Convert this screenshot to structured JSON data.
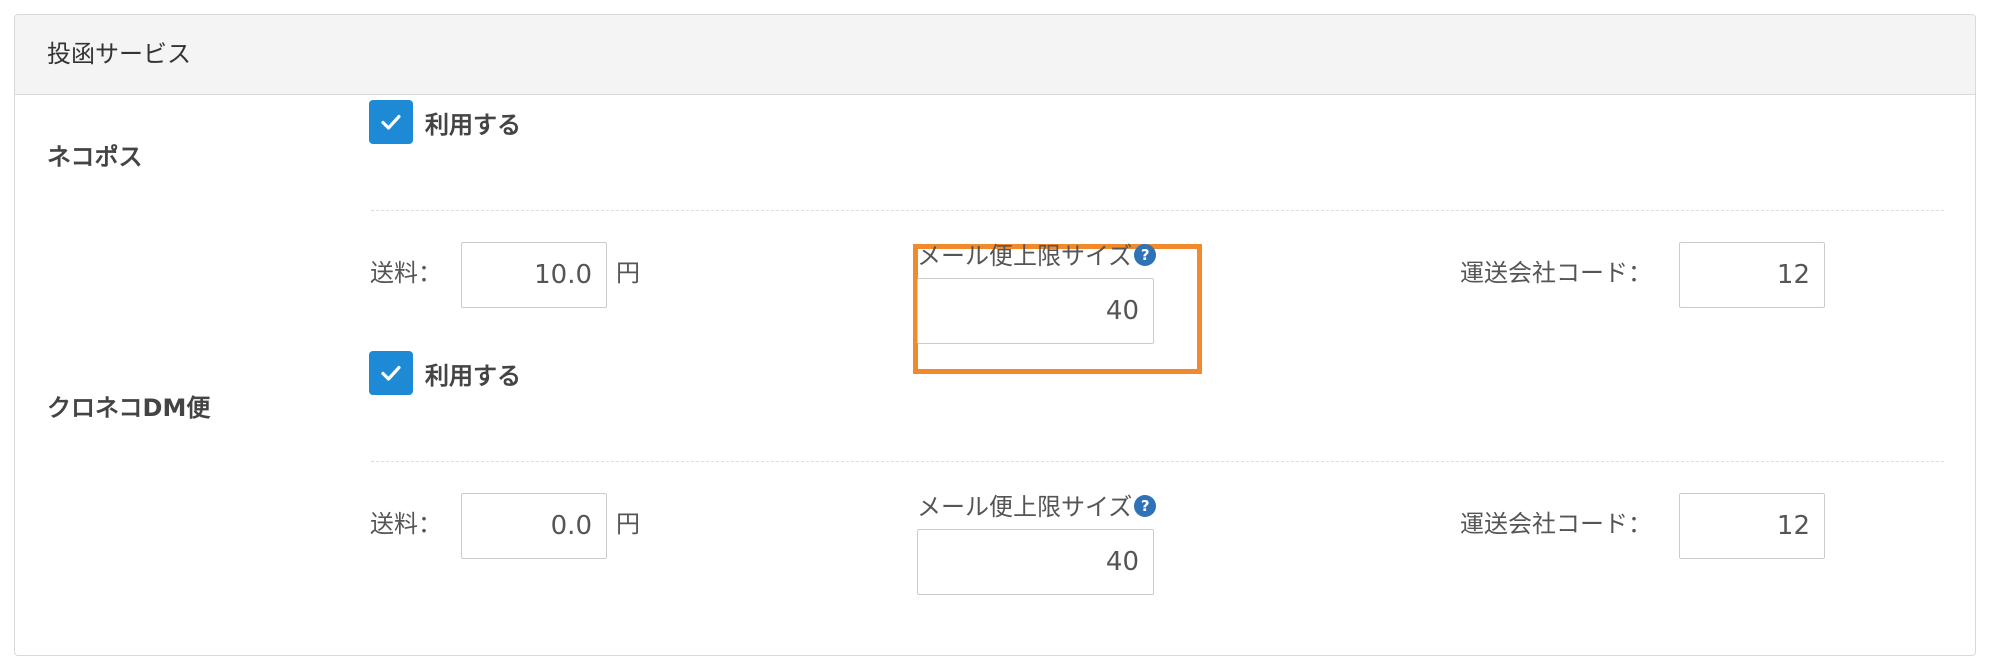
{
  "panel": {
    "title": "投函サービス"
  },
  "services": [
    {
      "name": "ネコポス",
      "use_checkbox": {
        "checked": true,
        "label": "利用する"
      },
      "shipping_fee": {
        "label": "送料：",
        "value": "10.0",
        "unit": "円"
      },
      "mail_size_limit": {
        "label": "メール便上限サイズ",
        "value": "40",
        "help_icon": "question-circle-icon"
      },
      "carrier_code": {
        "label": "運送会社コード：",
        "value": "12"
      }
    },
    {
      "name": "クロネコDM便",
      "use_checkbox": {
        "checked": true,
        "label": "利用する"
      },
      "shipping_fee": {
        "label": "送料：",
        "value": "0.0",
        "unit": "円"
      },
      "mail_size_limit": {
        "label": "メール便上限サイズ",
        "value": "40",
        "help_icon": "question-circle-icon"
      },
      "carrier_code": {
        "label": "運送会社コード：",
        "value": "12"
      }
    }
  ],
  "colors": {
    "checkbox": "#1e8ad6",
    "help_icon": "#2f72b8",
    "highlight": "#f28a2c"
  }
}
